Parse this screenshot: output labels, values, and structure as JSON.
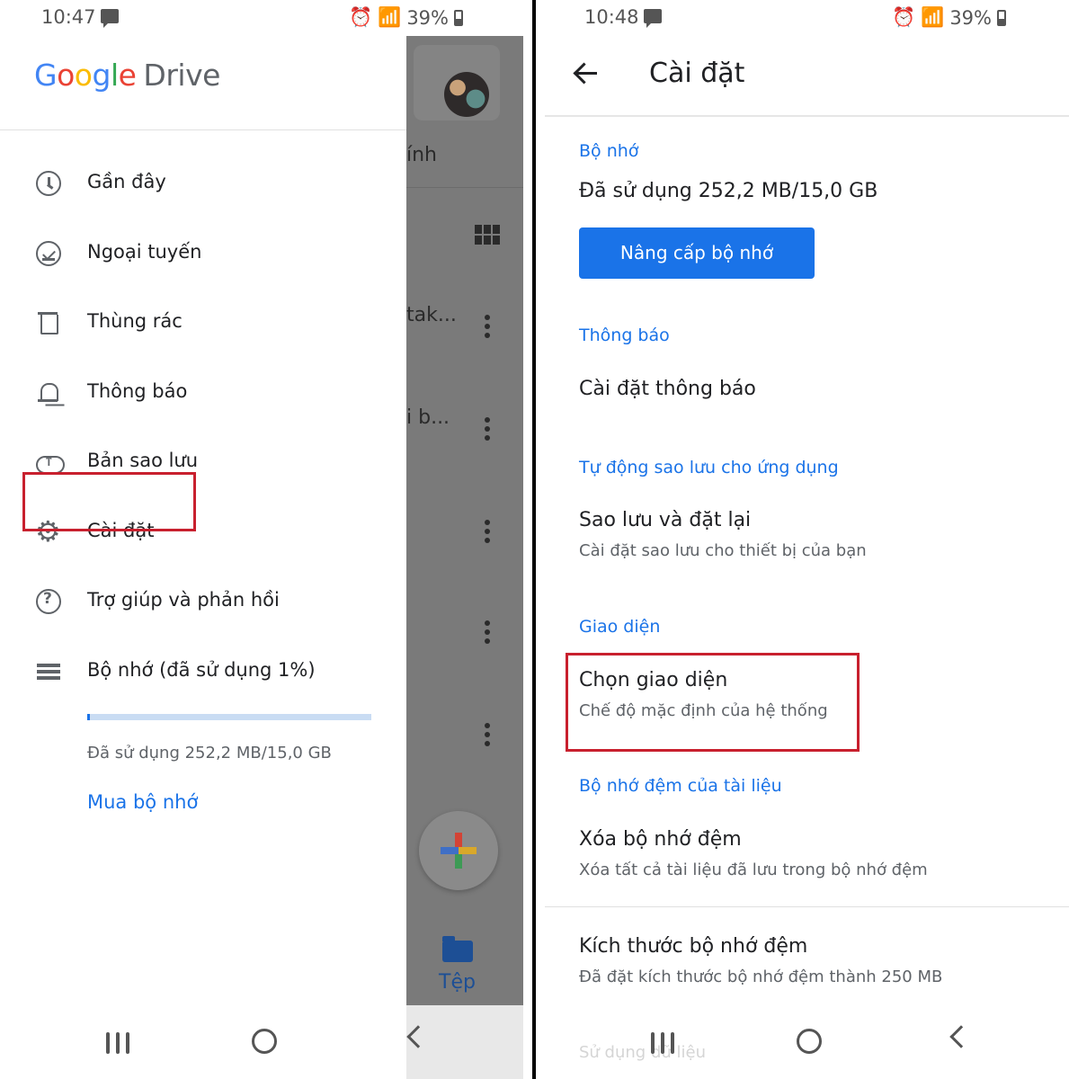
{
  "left": {
    "status": {
      "time": "10:47",
      "battery": "39%"
    },
    "drawer": {
      "logo_letters": [
        "G",
        "o",
        "o",
        "g",
        "l",
        "e"
      ],
      "logo_suffix": "Drive",
      "items": [
        {
          "label": "Gần đây",
          "icon": "clock-icon"
        },
        {
          "label": "Ngoại tuyến",
          "icon": "offline-icon"
        },
        {
          "label": "Thùng rác",
          "icon": "trash-icon"
        },
        {
          "label": "Thông báo",
          "icon": "bell-icon"
        },
        {
          "label": "Bản sao lưu",
          "icon": "cloud-upload-icon"
        },
        {
          "label": "Cài đặt",
          "icon": "gear-icon"
        },
        {
          "label": "Trợ giúp và phản hồi",
          "icon": "help-icon"
        },
        {
          "label": "Bộ nhớ (đã sử dụng 1%)",
          "icon": "storage-icon"
        }
      ],
      "storage_progress_percent": 1,
      "storage_used_text": "Đã sử dụng 252,2 MB/15,0 GB",
      "buy_storage_link": "Mua bộ nhớ"
    },
    "background_app": {
      "partial_texts": [
        "ính",
        "tak...",
        "i b..."
      ],
      "files_tab_label": "Tệp"
    }
  },
  "right": {
    "status": {
      "time": "10:48",
      "battery": "39%"
    },
    "appbar": {
      "title": "Cài đặt"
    },
    "sections": {
      "storage": {
        "header": "Bộ nhớ",
        "used": "Đã sử dụng 252,2 MB/15,0 GB",
        "upgrade_button": "Nâng cấp bộ nhớ"
      },
      "notifications": {
        "header": "Thông báo",
        "item_title": "Cài đặt thông báo"
      },
      "backup": {
        "header": "Tự động sao lưu cho ứng dụng",
        "item_title": "Sao lưu và đặt lại",
        "item_sub": "Cài đặt sao lưu cho thiết bị của bạn"
      },
      "theme": {
        "header": "Giao diện",
        "item_title": "Chọn giao diện",
        "item_sub": "Chế độ mặc định của hệ thống"
      },
      "cache": {
        "header": "Bộ nhớ đệm của tài liệu",
        "clear_title": "Xóa bộ nhớ đệm",
        "clear_sub": "Xóa tất cả tài liệu đã lưu trong bộ nhớ đệm",
        "size_title": "Kích thước bộ nhớ đệm",
        "size_sub": "Đã đặt kích thước bộ nhớ đệm thành 250 MB"
      },
      "faded_item": "Sử dụng dữ liệu"
    }
  }
}
